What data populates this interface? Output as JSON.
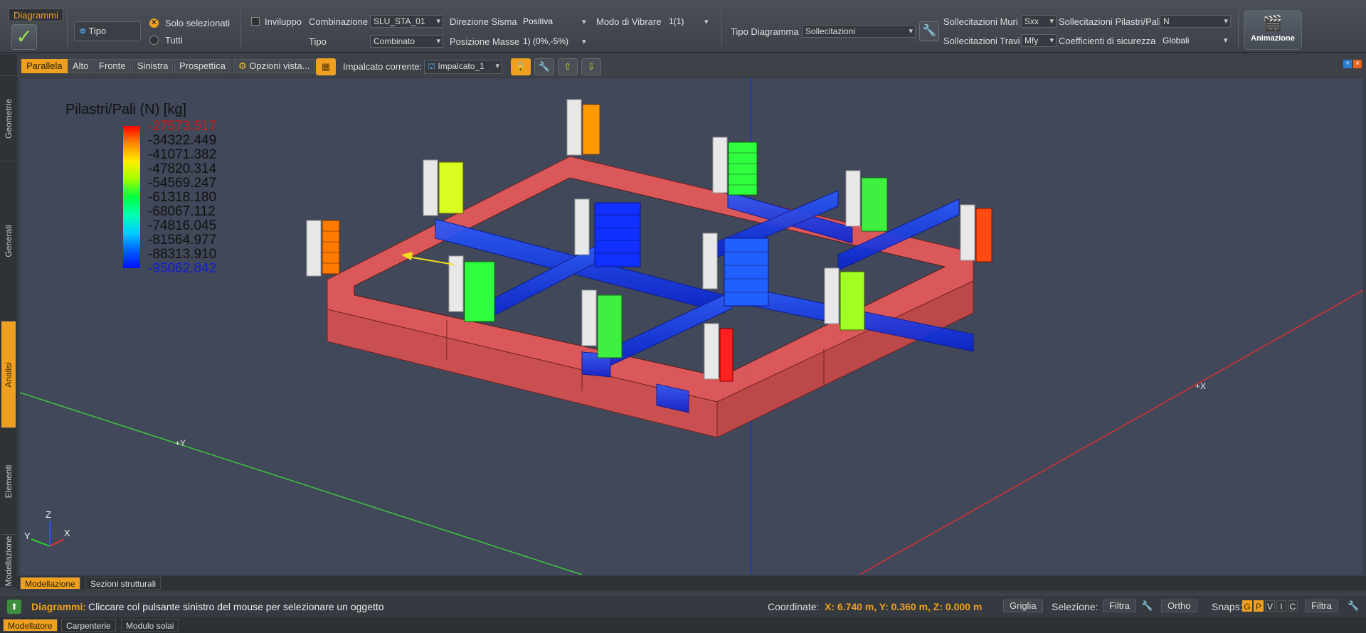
{
  "ribbon": {
    "tab": "Diagrammi",
    "tipo_button": "Tipo",
    "radio_selected": "Solo selezionati",
    "radio_all": "Tutti",
    "inviluppo": "Inviluppo",
    "combinazione_label": "Combinazione",
    "combinazione_value": "SLU_STA_01",
    "tipo_label": "Tipo",
    "tipo_value": "Combinato",
    "direzione_label": "Direzione Sisma",
    "direzione_value": "Positiva",
    "posizione_label": "Posizione Masse",
    "posizione_value": "1) (0%,-5%)",
    "modo_label": "Modo di Vibrare",
    "modo_value": "1(1)",
    "tipo_diagramma_label": "Tipo Diagramma",
    "tipo_diagramma_value": "Sollecitazioni",
    "muri_label": "Sollecitazioni Muri",
    "muri_value": "Sxx",
    "travi_label": "Sollecitazioni Travi",
    "travi_value": "Mfy",
    "pilastri_label": "Sollecitazioni Pilastri/Pali",
    "pilastri_value": "N",
    "coeff_label": "Coefficienti di sicurezza",
    "coeff_value": "Globali",
    "animazione": "Animazione"
  },
  "side_tabs": [
    "Geometrie",
    "Generali",
    "Analisi",
    "Elementi",
    "Modellazione"
  ],
  "view_buttons": [
    "Parallela",
    "Alto",
    "Fronte",
    "Sinistra",
    "Prospettica"
  ],
  "opzioni_vista": "Opzioni vista...",
  "impalcato_label": "Impalcato corrente:",
  "impalcato_value": "Impalcato_1",
  "legend": {
    "title": "Pilastri/Pali (N) [kg]",
    "values": [
      "-27573.517",
      "-34322.449",
      "-41071.382",
      "-47820.314",
      "-54569.247",
      "-61318.180",
      "-68067.112",
      "-74816.045",
      "-81564.977",
      "-88313.910",
      "-95062.842"
    ]
  },
  "axes": {
    "plus_x": "+X",
    "plus_y": "+Y",
    "z": "Z",
    "x": "X",
    "y": "Y"
  },
  "bottom_tabs": [
    "Modellazione",
    "Sezioni strutturali"
  ],
  "status": {
    "prefix": "Diagrammi:",
    "message": "Cliccare col pulsante sinistro del mouse per selezionare un oggetto",
    "coord_label": "Coordinate:",
    "coord_value": "X: 6.740 m, Y: 0.360 m, Z: 0.000 m",
    "griglia": "Griglia",
    "selezione": "Selezione:",
    "filtra": "Filtra",
    "ortho": "Ortho",
    "snaps": "Snaps:",
    "snap_letters": [
      "G",
      "P",
      "V",
      "I",
      "C"
    ],
    "filtra2": "Filtra"
  },
  "module_tabs": [
    "Modellatore",
    "Carpenterie",
    "Modulo solai"
  ]
}
